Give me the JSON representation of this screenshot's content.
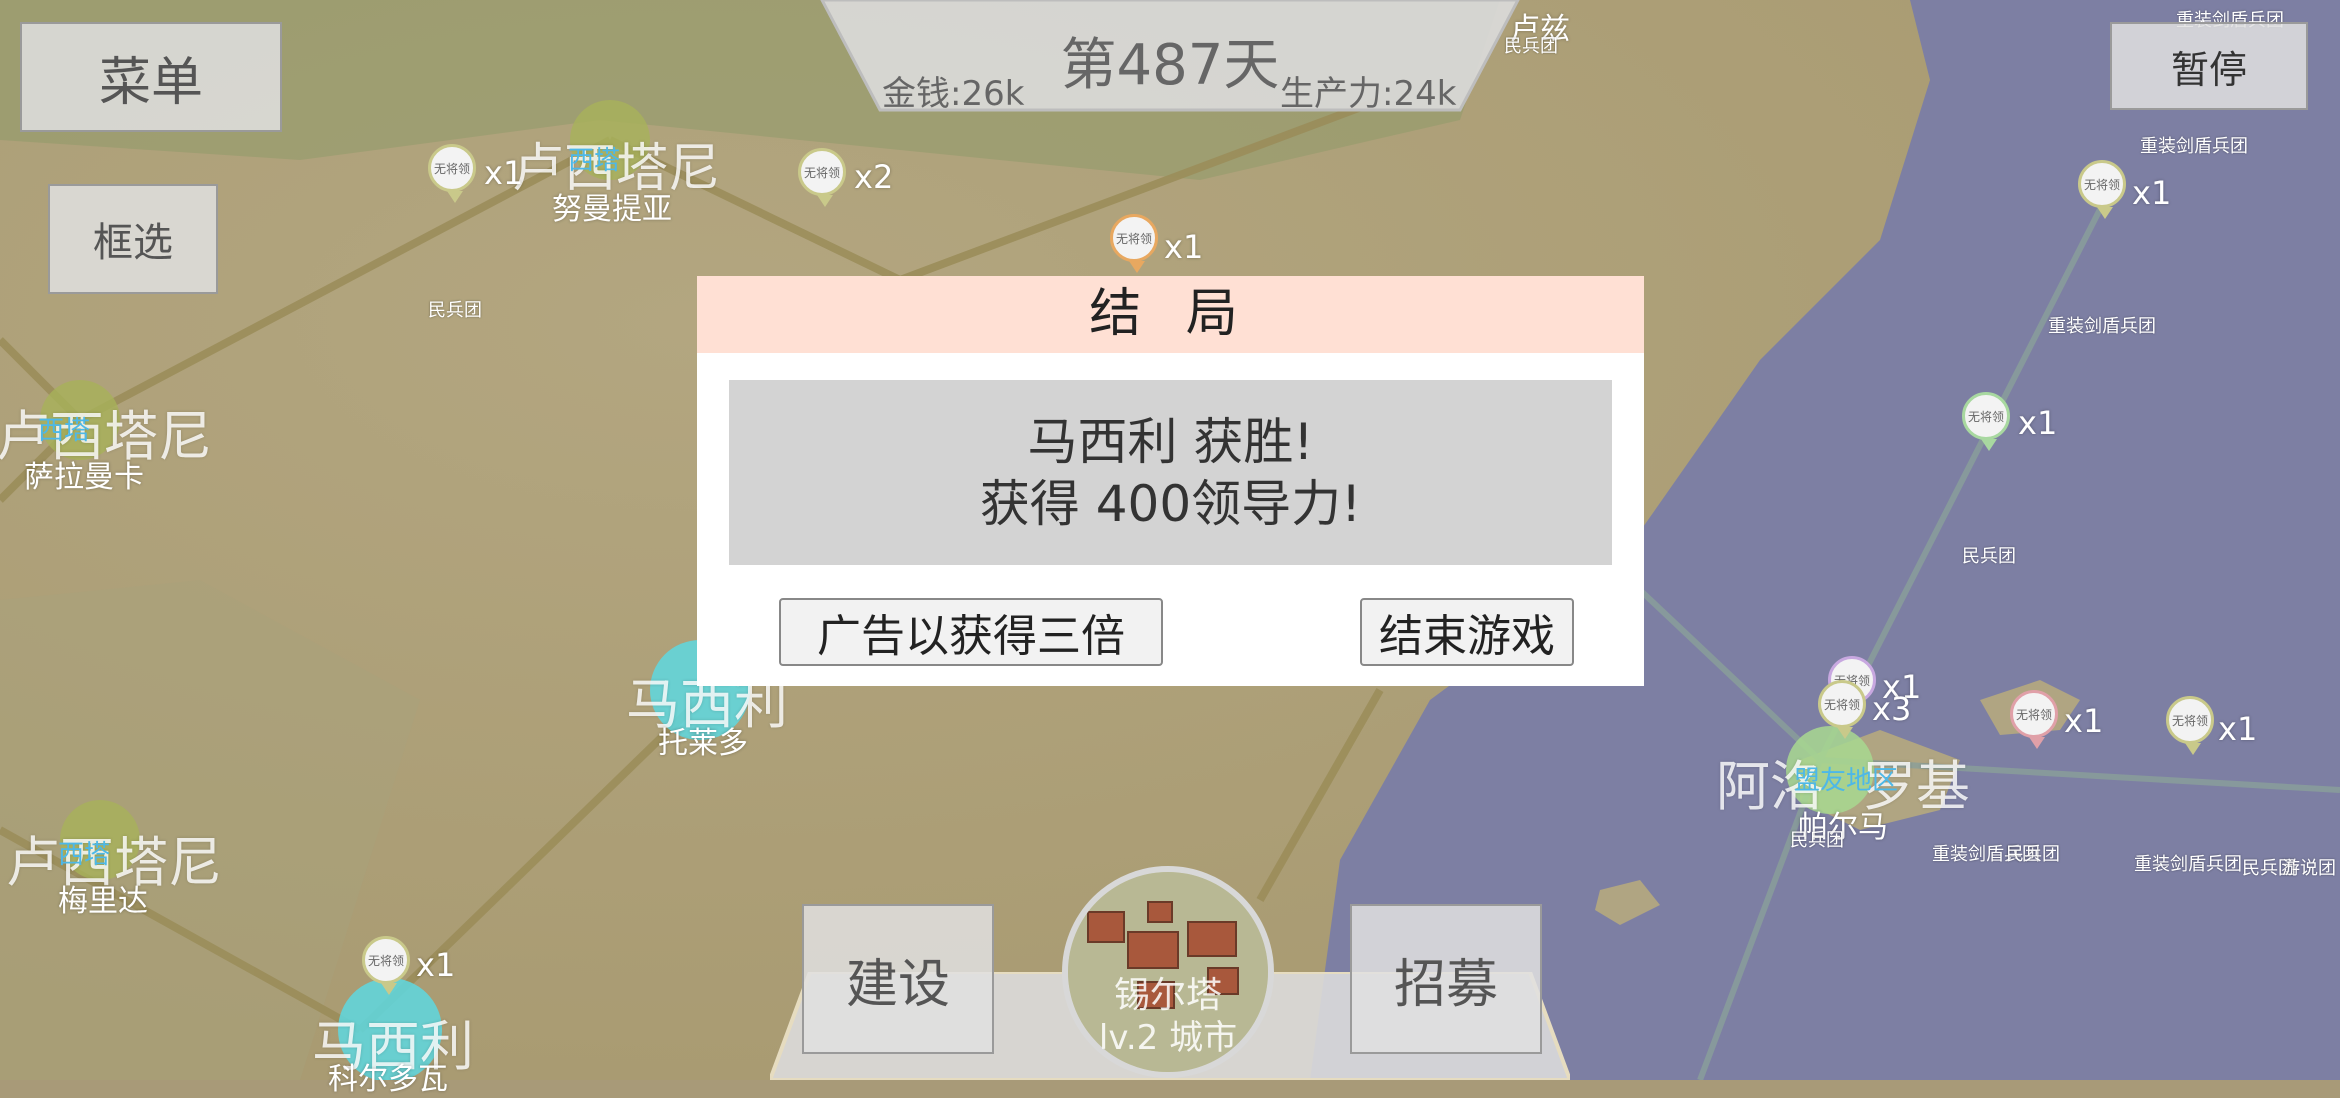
{
  "top_bar": {
    "day": "第487天",
    "money": "金钱:26k",
    "productivity": "生产力:24k",
    "menu_label": "菜单",
    "select_label": "框选",
    "pause_label": "暂停"
  },
  "map": {
    "labels": {
      "lusitania_1": "卢西塔尼",
      "numantia": "努曼提亚",
      "lusitania_2": "卢西塔尼",
      "salamanca": "萨拉曼卡",
      "lusitania_3": "卢西塔尼",
      "merida": "梅里达",
      "massilia_mid": "马西利",
      "toledo": "托莱多",
      "massilia_bottom": "马西利",
      "cordoba": "科尔多瓦",
      "arosa_top": "卢兹",
      "militia_top": "民兵团",
      "militia_left": "民兵团",
      "aolo": "阿洛",
      "luoji": "罗基",
      "ally_zone": "盟友地区",
      "palma": "帕尔马",
      "ally_tag_1": "西塔",
      "ally_tag_2": "西塔",
      "ally_tag_3": "西塔",
      "heavy_1": "重装剑盾兵团",
      "heavy_2": "重装剑盾兵团",
      "heavy_3": "重装剑盾兵团",
      "heavy_4": "重装剑盾兵团",
      "militia_sea": "民兵团",
      "militia_sea2": "民兵团",
      "militia_sea3": "民兵团",
      "militia_sea4": "民兵团",
      "defense": "重装剑盾兵团",
      "persuade": "游说团"
    },
    "pins": [
      {
        "text": "无将领",
        "count": "x1"
      },
      {
        "text": "无将领",
        "count": "x2"
      },
      {
        "text": "无将领",
        "count": "x1"
      },
      {
        "text": "无将领",
        "count": "x1"
      },
      {
        "text": "无将领",
        "count": "x1"
      },
      {
        "text": "无将领",
        "count": "x1"
      },
      {
        "text": "无将领",
        "count": "x3"
      },
      {
        "text": "无将领",
        "count": "x1"
      },
      {
        "text": "无将领",
        "count": "x1"
      },
      {
        "text": "无将领",
        "count": "x1"
      }
    ]
  },
  "dialog": {
    "title": "结 局",
    "line1": "马西利 获胜!",
    "line2": "获得 400领导力!",
    "ad_button": "广告以获得三倍",
    "end_button": "结束游戏"
  },
  "bottom": {
    "build_label": "建设",
    "recruit_label": "招募",
    "city_name": "锡尔塔",
    "city_level": "lv.2 城市"
  },
  "colors": {
    "dialog_header": "#ffe0d4",
    "dialog_message_bg": "#d3d3d3",
    "sea": "#7d7fa3",
    "land": "#b5a67f"
  }
}
